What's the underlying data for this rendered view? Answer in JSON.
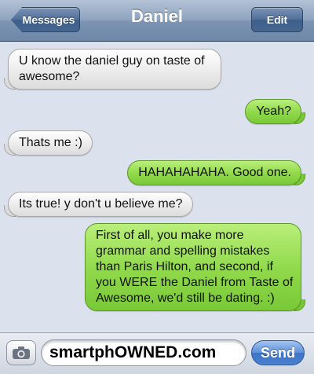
{
  "header": {
    "back_label": "Messages",
    "title": "Daniel",
    "edit_label": "Edit"
  },
  "messages": [
    {
      "direction": "incoming",
      "text": "U know the daniel guy on taste of awesome?"
    },
    {
      "direction": "outgoing",
      "text": "Yeah?"
    },
    {
      "direction": "incoming",
      "text": "Thats me :)"
    },
    {
      "direction": "outgoing",
      "text": "HAHAHAHAHA. Good one."
    },
    {
      "direction": "incoming",
      "text": "Its true! y don't u believe me?"
    },
    {
      "direction": "outgoing",
      "text": "First of all, you make more grammar and spelling mistakes than Paris Hilton, and second, if you WERE the Daniel from Taste of Awesome, we'd still be dating. :)"
    }
  ],
  "compose": {
    "camera_icon": "camera-icon",
    "input_value": "smartphOWNED.com",
    "send_label": "Send"
  },
  "colors": {
    "incoming_bubble": "#e6e6e6",
    "outgoing_bubble": "#8fd84a",
    "header": "#8fa4c0",
    "send_button": "#4a80cf"
  }
}
